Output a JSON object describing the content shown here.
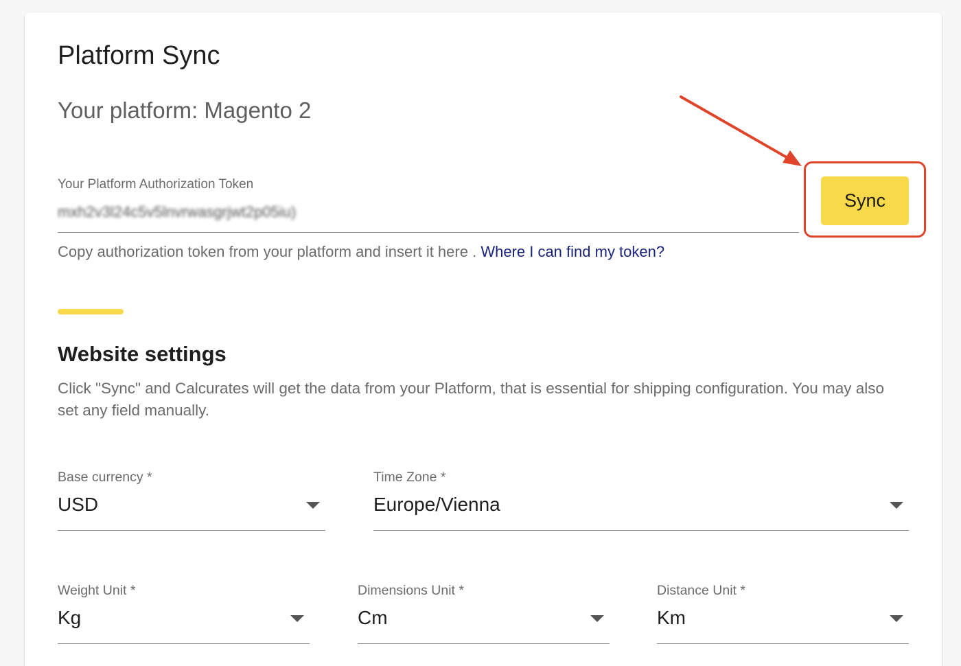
{
  "page": {
    "title": "Platform Sync",
    "platform_line": "Your platform: Magento 2"
  },
  "token": {
    "label": "Your Platform Authorization Token",
    "value": "mxh2v3l24c5v5lnvrwasgrjwt2p05iu)",
    "helper_text": "Copy authorization token from your platform and insert it here . ",
    "helper_link": "Where I can find my token?"
  },
  "sync_button": {
    "label": "Sync"
  },
  "website_settings": {
    "title": "Website settings",
    "description": "Click \"Sync\" and Calcurates will get the data from your Platform, that is essential for shipping configuration. You may also set any field manually."
  },
  "fields": {
    "base_currency": {
      "label": "Base currency *",
      "value": "USD"
    },
    "time_zone": {
      "label": "Time Zone *",
      "value": "Europe/Vienna"
    },
    "weight_unit": {
      "label": "Weight Unit *",
      "value": "Kg"
    },
    "dimensions_unit": {
      "label": "Dimensions Unit *",
      "value": "Cm"
    },
    "distance_unit": {
      "label": "Distance Unit *",
      "value": "Km"
    }
  },
  "colors": {
    "accent_yellow": "#f8d949",
    "annotation_red": "#e0452b",
    "link_blue": "#1a237e"
  }
}
